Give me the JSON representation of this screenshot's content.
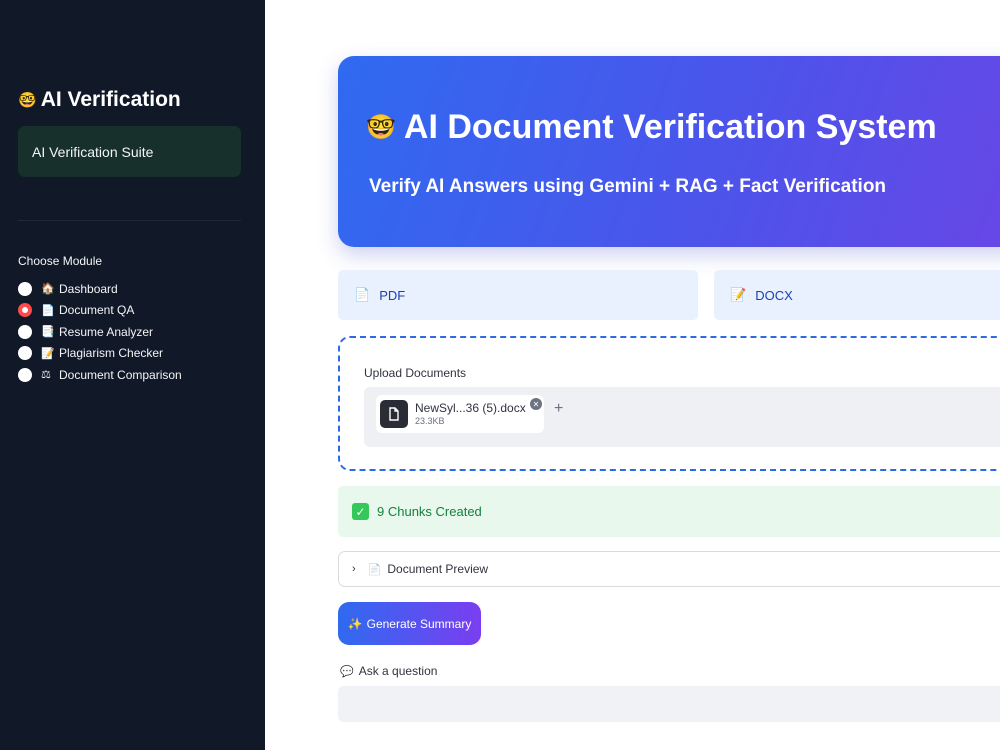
{
  "sidebar": {
    "title_icon": "🤓",
    "title": "AI Verification",
    "suite_label": "AI Verification Suite",
    "choose_label": "Choose Module",
    "modules": [
      {
        "icon": "🏠",
        "label": "Dashboard",
        "selected": false
      },
      {
        "icon": "📄",
        "label": "Document QA",
        "selected": true
      },
      {
        "icon": "📑",
        "label": "Resume Analyzer",
        "selected": false
      },
      {
        "icon": "📝",
        "label": "Plagiarism Checker",
        "selected": false
      },
      {
        "icon": "⚖",
        "label": "Document Comparison",
        "selected": false
      }
    ]
  },
  "hero": {
    "icon": "🤓",
    "title": "AI Document Verification System",
    "subtitle": "Verify AI Answers using Gemini + RAG + Fact Verification"
  },
  "file_types": [
    {
      "icon": "📄",
      "label": "PDF"
    },
    {
      "icon": "📝",
      "label": "DOCX"
    }
  ],
  "upload": {
    "label": "Upload Documents",
    "file": {
      "name": "NewSyl...36 (5).docx",
      "size": "23.3KB"
    },
    "add_symbol": "+"
  },
  "status": {
    "check": "✓",
    "message": "9 Chunks Created"
  },
  "preview": {
    "chevron": "›",
    "icon": "📄",
    "label": "Document Preview"
  },
  "summary_button": {
    "icon": "✨",
    "label": "Generate Summary"
  },
  "question": {
    "icon": "💬",
    "label": "Ask a question",
    "value": ""
  },
  "colors": {
    "sidebar_bg": "#111827",
    "hero_start": "#2f6af0",
    "hero_end": "#6a46e6",
    "radio_selected": "#ff4b4b",
    "success_text": "#15803d"
  }
}
